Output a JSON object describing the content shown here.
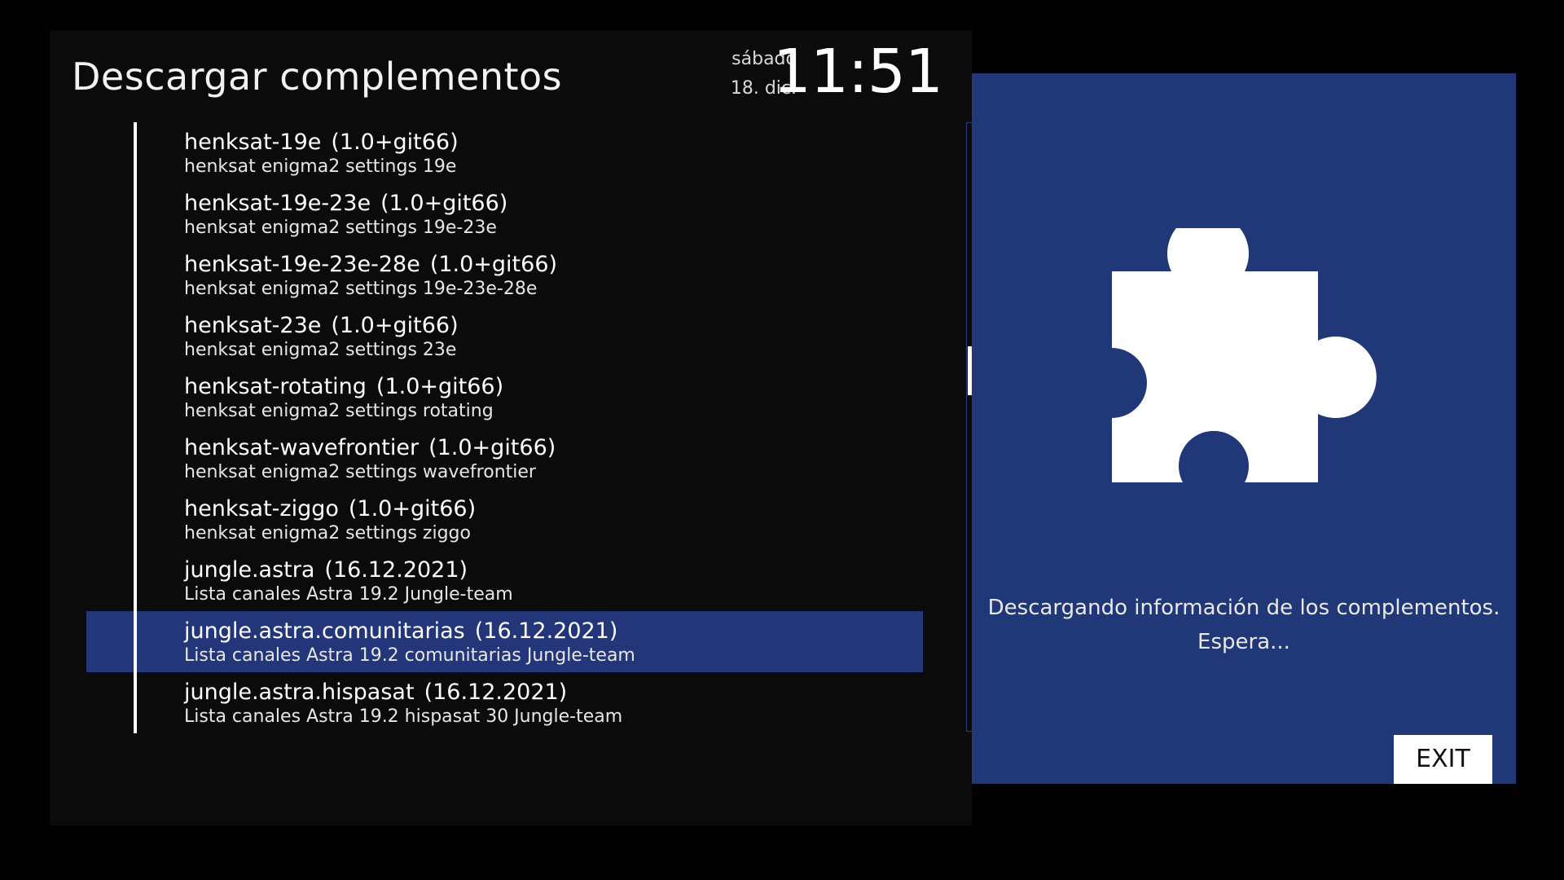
{
  "header": {
    "title": "Descargar complementos",
    "day": "sábado",
    "date": "18. dic.",
    "time": "11:51"
  },
  "list": {
    "items": [
      {
        "name": "henksat-19e",
        "version": "(1.0+git66)",
        "description": "henksat enigma2 settings 19e",
        "selected": false
      },
      {
        "name": "henksat-19e-23e",
        "version": "(1.0+git66)",
        "description": "henksat enigma2 settings 19e-23e",
        "selected": false
      },
      {
        "name": "henksat-19e-23e-28e",
        "version": "(1.0+git66)",
        "description": "henksat enigma2 settings 19e-23e-28e",
        "selected": false
      },
      {
        "name": "henksat-23e",
        "version": "(1.0+git66)",
        "description": "henksat enigma2 settings 23e",
        "selected": false
      },
      {
        "name": "henksat-rotating",
        "version": "(1.0+git66)",
        "description": "henksat enigma2 settings rotating",
        "selected": false
      },
      {
        "name": "henksat-wavefrontier",
        "version": "(1.0+git66)",
        "description": "henksat enigma2 settings wavefrontier",
        "selected": false
      },
      {
        "name": "henksat-ziggo",
        "version": "(1.0+git66)",
        "description": "henksat enigma2 settings ziggo",
        "selected": false
      },
      {
        "name": "jungle.astra",
        "version": "(16.12.2021)",
        "description": "Lista canales Astra 19.2 Jungle-team",
        "selected": false
      },
      {
        "name": "jungle.astra.comunitarias",
        "version": "(16.12.2021)",
        "description": "Lista canales Astra 19.2 comunitarias Jungle-team",
        "selected": true
      },
      {
        "name": "jungle.astra.hispasat",
        "version": "(16.12.2021)",
        "description": "Lista canales Astra 19.2 hispasat 30 Jungle-team",
        "selected": false
      }
    ],
    "scroll_position": 0.4
  },
  "info_panel": {
    "icon": "puzzle-piece-icon",
    "message_line1": "Descargando información de los complementos.",
    "message_line2": "Espera...",
    "exit_label": "EXIT"
  },
  "colors": {
    "panel_background": "#0b0b0b",
    "selection": "#223679",
    "info_panel": "#213878",
    "text": "#ffffff"
  }
}
